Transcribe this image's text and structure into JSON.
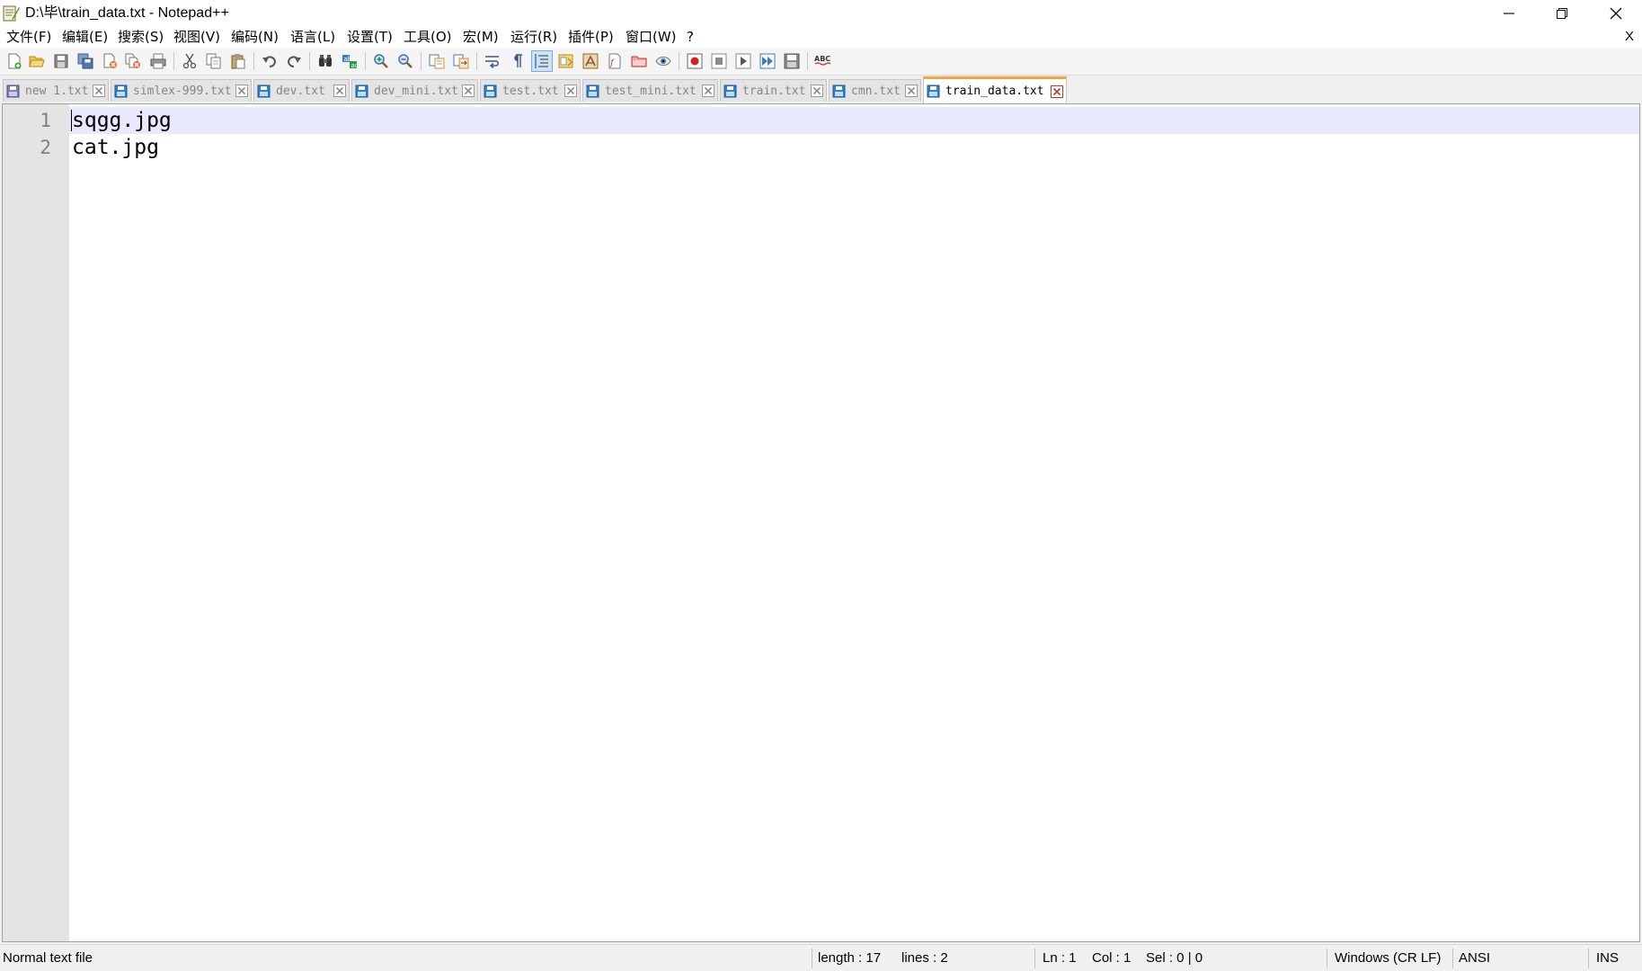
{
  "window": {
    "title": "D:\\毕\\train_data.txt - Notepad++",
    "minimize_glyph": "—",
    "restore_glyph": "❐",
    "close_glyph": "✕"
  },
  "menu": {
    "items": [
      "文件(F)",
      "编辑(E)",
      "搜索(S)",
      "视图(V)",
      "编码(N)",
      "语言(L)",
      "设置(T)",
      "工具(O)",
      "宏(M)",
      "运行(R)",
      "插件(P)",
      "窗口(W)",
      "?"
    ],
    "close_doc": "X"
  },
  "toolbar": {
    "buttons": [
      "new",
      "open",
      "save",
      "save-all",
      "close",
      "close-all",
      "print",
      "cut",
      "copy",
      "paste",
      "undo",
      "redo",
      "find",
      "replace",
      "zoom-in",
      "zoom-out",
      "sync-vertical",
      "sync-horizontal",
      "word-wrap",
      "show-all-chars",
      "indent-guide",
      "document-map",
      "function-list",
      "folder-workspace",
      "monitoring",
      "record-macro",
      "stop-record",
      "play-macro",
      "run-macro-multiple",
      "save-macro",
      "spell-check"
    ],
    "active": [
      "indent-guide"
    ]
  },
  "tabs": [
    {
      "label": "new 1.txt",
      "active": false,
      "icon": "unsaved-file-icon"
    },
    {
      "label": "simlex-999.txt",
      "active": false,
      "icon": "saved-file-icon"
    },
    {
      "label": "dev.txt",
      "active": false,
      "icon": "saved-file-icon"
    },
    {
      "label": "dev_mini.txt",
      "active": false,
      "icon": "saved-file-icon"
    },
    {
      "label": "test.txt",
      "active": false,
      "icon": "saved-file-icon"
    },
    {
      "label": "test_mini.txt",
      "active": false,
      "icon": "saved-file-icon"
    },
    {
      "label": "train.txt",
      "active": false,
      "icon": "saved-file-icon"
    },
    {
      "label": "cmn.txt",
      "active": false,
      "icon": "saved-file-icon"
    },
    {
      "label": "train_data.txt",
      "active": true,
      "icon": "saved-file-icon"
    }
  ],
  "editor": {
    "lines": [
      {
        "number": "1",
        "text": "sqgg.jpg"
      },
      {
        "number": "2",
        "text": "cat.jpg"
      }
    ],
    "current_line": 1
  },
  "status": {
    "file_type": "Normal text file",
    "length": "length : 17",
    "lines": "lines : 2",
    "ln": "Ln : 1",
    "col": "Col : 1",
    "sel": "Sel : 0 | 0",
    "eol": "Windows (CR LF)",
    "encoding": "ANSI",
    "mode": "INS"
  },
  "colors": {
    "active_tab_accent": "#f9a33b",
    "current_line_bg": "#e8e8ff",
    "gutter_bg": "#e4e4e4",
    "saved_icon": "#2f7fc9",
    "close_icon": "#c0392b"
  }
}
